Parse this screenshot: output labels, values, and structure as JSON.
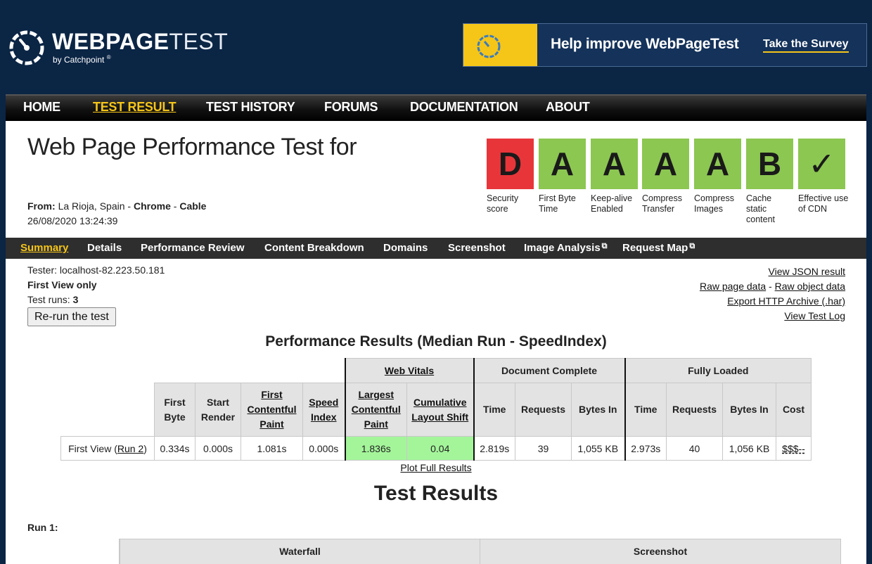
{
  "header": {
    "logo_bold": "WEBPAGE",
    "logo_thin": "TEST",
    "logo_sub": "by Catchpoint",
    "logo_reg": "®",
    "banner_title": "Help improve WebPageTest",
    "banner_cta": "Take the Survey"
  },
  "main_nav": [
    {
      "label": "HOME"
    },
    {
      "label": "TEST RESULT"
    },
    {
      "label": "TEST HISTORY"
    },
    {
      "label": "FORUMS"
    },
    {
      "label": "DOCUMENTATION"
    },
    {
      "label": "ABOUT"
    }
  ],
  "summary": {
    "title": "Web Page Performance Test for",
    "from_label": "From:",
    "location": "La Rioja, Spain",
    "sep": " - ",
    "browser": "Chrome",
    "connection": "Cable",
    "date": "26/08/2020 13:24:39"
  },
  "grades": [
    {
      "grade": "D",
      "label": "Security score",
      "color": "#e8353a"
    },
    {
      "grade": "A",
      "label": "First Byte Time",
      "color": "#8cc751"
    },
    {
      "grade": "A",
      "label": "Keep-alive Enabled",
      "color": "#8cc751"
    },
    {
      "grade": "A",
      "label": "Compress Transfer",
      "color": "#8cc751"
    },
    {
      "grade": "A",
      "label": "Compress Images",
      "color": "#8cc751"
    },
    {
      "grade": "B",
      "label": "Cache static content",
      "color": "#8cc751"
    },
    {
      "grade": "✓",
      "label": "Effective use of CDN",
      "color": "#8cc751"
    }
  ],
  "sub_nav": [
    {
      "label": "Summary"
    },
    {
      "label": "Details"
    },
    {
      "label": "Performance Review"
    },
    {
      "label": "Content Breakdown"
    },
    {
      "label": "Domains"
    },
    {
      "label": "Screenshot"
    },
    {
      "label": "Image Analysis"
    },
    {
      "label": "Request Map"
    }
  ],
  "test_info": {
    "tester": "Tester: localhost-82.223.50.181",
    "first_view_only": "First View only",
    "test_runs_label": "Test runs: ",
    "test_runs": "3",
    "rerun_button": "Re-run the test"
  },
  "right_links": {
    "view_json": "View JSON result",
    "raw_page": "Raw page data",
    "dash": " - ",
    "raw_object": "Raw object data",
    "export_har": "Export HTTP Archive (.har)",
    "view_log": "View Test Log"
  },
  "perf": {
    "title": "Performance Results (Median Run - SpeedIndex)",
    "groups": {
      "web_vitals": "Web Vitals",
      "document_complete": "Document Complete",
      "fully_loaded": "Fully Loaded"
    },
    "columns": {
      "first_byte": "First Byte",
      "start_render": "Start Render",
      "fcp": "First Contentful Paint",
      "speed_index": "Speed Index",
      "lcp": "Largest Contentful Paint",
      "cls": "Cumulative Layout Shift",
      "dc_time": "Time",
      "dc_requests": "Requests",
      "dc_bytes": "Bytes In",
      "fl_time": "Time",
      "fl_requests": "Requests",
      "fl_bytes": "Bytes In",
      "cost": "Cost"
    },
    "row": {
      "label_prefix": "First View (",
      "run_link": "Run 2",
      "label_suffix": ")",
      "first_byte": "0.334s",
      "start_render": "0.000s",
      "fcp": "1.081s",
      "speed_index": "0.000s",
      "lcp": "1.836s",
      "cls": "0.04",
      "dc_time": "2.819s",
      "dc_requests": "39",
      "dc_bytes": "1,055 KB",
      "fl_time": "2.973s",
      "fl_requests": "40",
      "fl_bytes": "1,056 KB",
      "cost": "$$$--"
    },
    "plot_link": "Plot Full Results"
  },
  "results": {
    "title": "Test Results",
    "run_label": "Run 1:",
    "waterfall": "Waterfall",
    "screenshot": "Screenshot"
  }
}
